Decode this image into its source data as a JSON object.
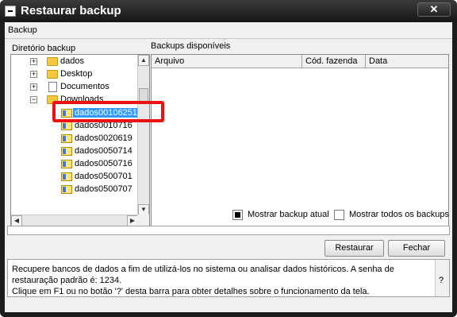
{
  "window": {
    "title": "Restaurar backup",
    "close_glyph": "✕"
  },
  "menu": {
    "backup": "Backup"
  },
  "tree_panel": {
    "label": "Diretório backup",
    "items": [
      {
        "label": "dados",
        "icon": "folder-icon",
        "expander": "+"
      },
      {
        "label": "Desktop",
        "icon": "folder-icon",
        "expander": "+"
      },
      {
        "label": "Documentos",
        "icon": "document-icon",
        "expander": "+"
      },
      {
        "label": "Downloads",
        "icon": "folder-icon",
        "expander": "−"
      },
      {
        "label": "dados00106251",
        "icon": "database-icon",
        "selected": true
      },
      {
        "label": "dados0010716",
        "icon": "database-icon"
      },
      {
        "label": "dados0020619",
        "icon": "database-icon"
      },
      {
        "label": "dados0050714",
        "icon": "database-icon"
      },
      {
        "label": "dados0050716",
        "icon": "database-icon"
      },
      {
        "label": "dados0500701",
        "icon": "database-icon"
      },
      {
        "label": "dados0500707",
        "icon": "database-icon"
      }
    ]
  },
  "backups_panel": {
    "label": "Backups disponíveis",
    "columns": [
      "Arquivo",
      "Cód. fazenda",
      "Data"
    ]
  },
  "options": {
    "show_current": "Mostrar backup atual",
    "show_all": "Mostrar todos os backups",
    "show_current_checked": true,
    "show_all_checked": false
  },
  "progress": {
    "value": 0
  },
  "buttons": {
    "restore": "Restaurar",
    "close": "Fechar"
  },
  "help": {
    "line1": "Recupere bancos de dados a fim de utilizá-los no sistema ou analisar dados históricos. A senha de",
    "line2": "restauração padrão é: 1234.",
    "line3": "Clique em F1 ou no botão '?' desta barra para obter detalhes sobre o funcionamento da tela.",
    "help_button": "?"
  },
  "colors": {
    "selection": "#3399ff",
    "highlight": "#ee1111",
    "title_bar": "#1c1c1c"
  }
}
